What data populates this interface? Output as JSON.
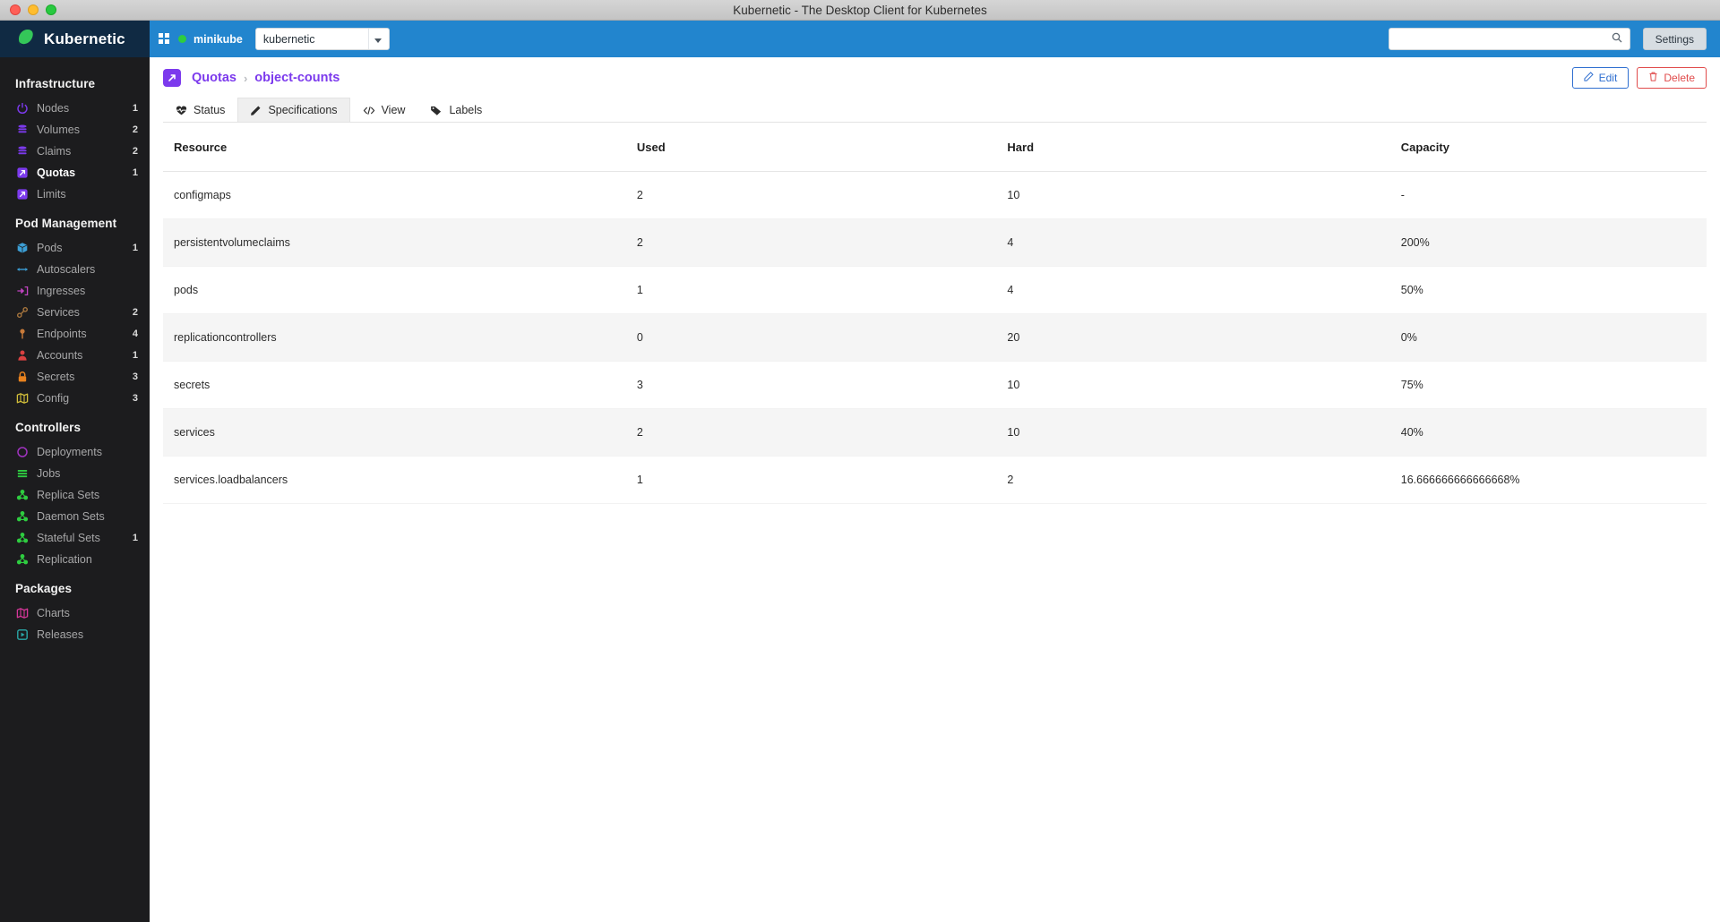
{
  "window": {
    "title": "Kubernetic - The Desktop Client for Kubernetes"
  },
  "brand": {
    "name": "Kubernetic"
  },
  "topbar": {
    "cluster": "minikube",
    "namespace": "kubernetic",
    "search_placeholder": "",
    "search_value": "",
    "settings_label": "Settings",
    "accent_color": "#2285ce"
  },
  "sidebar": {
    "groups": [
      {
        "title": "Infrastructure",
        "items": [
          {
            "label": "Nodes",
            "count": "1",
            "icon": "power-icon",
            "color": "#7c3aed",
            "active": false
          },
          {
            "label": "Volumes",
            "count": "2",
            "icon": "database-icon",
            "color": "#7c3aed",
            "active": false
          },
          {
            "label": "Claims",
            "count": "2",
            "icon": "database-icon",
            "color": "#7c3aed",
            "active": false
          },
          {
            "label": "Quotas",
            "count": "1",
            "icon": "quota-icon",
            "color": "#7c3aed",
            "active": true
          },
          {
            "label": "Limits",
            "count": "",
            "icon": "quota-icon",
            "color": "#7c3aed",
            "active": false
          }
        ]
      },
      {
        "title": "Pod Management",
        "items": [
          {
            "label": "Pods",
            "count": "1",
            "icon": "cube-icon",
            "color": "#3c9fd6",
            "active": false
          },
          {
            "label": "Autoscalers",
            "count": "",
            "icon": "arrows-icon",
            "color": "#3c9fd6",
            "active": false
          },
          {
            "label": "Ingresses",
            "count": "",
            "icon": "ingress-icon",
            "color": "#c043c0",
            "active": false
          },
          {
            "label": "Services",
            "count": "2",
            "icon": "link-icon",
            "color": "#a8763e",
            "active": false
          },
          {
            "label": "Endpoints",
            "count": "4",
            "icon": "pin-icon",
            "color": "#c97b3a",
            "active": false
          },
          {
            "label": "Accounts",
            "count": "1",
            "icon": "user-icon",
            "color": "#d94141",
            "active": false
          },
          {
            "label": "Secrets",
            "count": "3",
            "icon": "lock-icon",
            "color": "#e8821e",
            "active": false
          },
          {
            "label": "Config",
            "count": "3",
            "icon": "map-icon",
            "color": "#d4c03a",
            "active": false
          }
        ]
      },
      {
        "title": "Controllers",
        "items": [
          {
            "label": "Deployments",
            "count": "",
            "icon": "circle-icon",
            "color": "#a033c0",
            "active": false
          },
          {
            "label": "Jobs",
            "count": "",
            "icon": "lines-icon",
            "color": "#2ecc40",
            "active": false
          },
          {
            "label": "Replica Sets",
            "count": "",
            "icon": "cluster-icon",
            "color": "#2ecc40",
            "active": false
          },
          {
            "label": "Daemon Sets",
            "count": "",
            "icon": "cluster-icon",
            "color": "#2ecc40",
            "active": false
          },
          {
            "label": "Stateful Sets",
            "count": "1",
            "icon": "cluster-icon",
            "color": "#2ecc40",
            "active": false
          },
          {
            "label": "Replication",
            "count": "",
            "icon": "cluster-icon",
            "color": "#2ecc40",
            "active": false
          }
        ]
      },
      {
        "title": "Packages",
        "items": [
          {
            "label": "Charts",
            "count": "",
            "icon": "map-icon",
            "color": "#d6379a",
            "active": false
          },
          {
            "label": "Releases",
            "count": "",
            "icon": "play-icon",
            "color": "#2aa8a8",
            "active": false
          }
        ]
      }
    ]
  },
  "page": {
    "breadcrumb_root": "Quotas",
    "breadcrumb_separator": "›",
    "breadcrumb_current": "object-counts",
    "accent_color": "#7c3aed",
    "edit_label": "Edit",
    "delete_label": "Delete"
  },
  "tabs": [
    {
      "label": "Status",
      "icon": "heartbeat-icon",
      "active": false
    },
    {
      "label": "Specifications",
      "icon": "pencil-icon",
      "active": true
    },
    {
      "label": "View",
      "icon": "code-icon",
      "active": false
    },
    {
      "label": "Labels",
      "icon": "tag-icon",
      "active": false
    }
  ],
  "table": {
    "columns": [
      "Resource",
      "Used",
      "Hard",
      "Capacity"
    ],
    "rows": [
      {
        "resource": "configmaps",
        "used": "2",
        "hard": "10",
        "capacity": "-"
      },
      {
        "resource": "persistentvolumeclaims",
        "used": "2",
        "hard": "4",
        "capacity": "200%"
      },
      {
        "resource": "pods",
        "used": "1",
        "hard": "4",
        "capacity": "50%"
      },
      {
        "resource": "replicationcontrollers",
        "used": "0",
        "hard": "20",
        "capacity": "0%"
      },
      {
        "resource": "secrets",
        "used": "3",
        "hard": "10",
        "capacity": "75%"
      },
      {
        "resource": "services",
        "used": "2",
        "hard": "10",
        "capacity": "40%"
      },
      {
        "resource": "services.loadbalancers",
        "used": "1",
        "hard": "2",
        "capacity": "16.666666666666668%"
      }
    ]
  }
}
